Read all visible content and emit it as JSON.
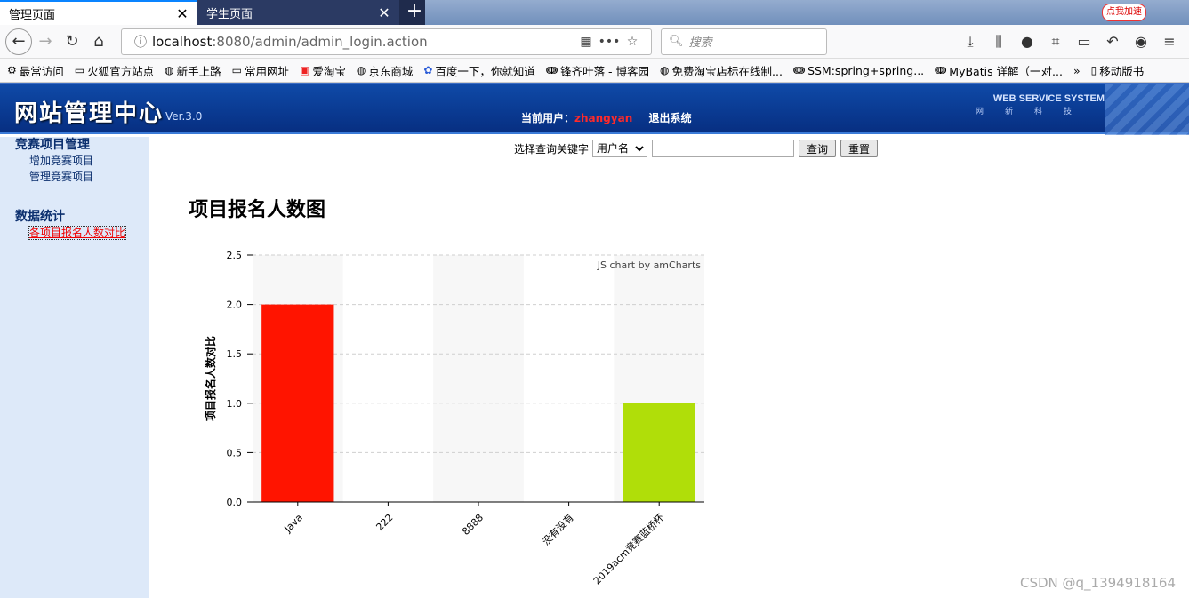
{
  "browser": {
    "tabs": [
      {
        "label": "管理页面",
        "close": "✕"
      },
      {
        "label": "学生页面",
        "close": "✕"
      }
    ],
    "newtab": "+",
    "accelerator": "点我加速",
    "url": {
      "host": "localhost",
      "path": ":8080/admin/admin_login.action"
    },
    "search_placeholder": "搜索",
    "bookmarks": [
      {
        "icon": "gear-icon",
        "label": "最常访问"
      },
      {
        "icon": "folder-icon",
        "label": "火狐官方站点"
      },
      {
        "icon": "globe-icon",
        "label": "新手上路"
      },
      {
        "icon": "folder-icon",
        "label": "常用网址"
      },
      {
        "icon": "taobao-icon",
        "label": "爱淘宝"
      },
      {
        "icon": "globe-icon",
        "label": "京东商城"
      },
      {
        "icon": "paw-icon",
        "label": "百度一下，你就知道"
      },
      {
        "icon": "cnblogs-icon",
        "label": "锋齐叶落 - 博客园"
      },
      {
        "icon": "globe-icon",
        "label": "免费淘宝店标在线制..."
      },
      {
        "icon": "cnblogs-icon",
        "label": "SSM:spring+spring..."
      },
      {
        "icon": "cnblogs-icon",
        "label": "MyBatis 详解（一对..."
      },
      {
        "icon": "overflow-icon",
        "label": "»"
      },
      {
        "icon": "mobile-icon",
        "label": "移动版书"
      }
    ]
  },
  "header": {
    "logo": "网站管理中心",
    "version": "Ver.3.0",
    "user_label": "当前用户：",
    "username": "zhangyan",
    "logout": "退出系统",
    "brand": "WEB SERVICE SYSTEM",
    "brand_sub": "网新科技"
  },
  "sidebar": {
    "groups": [
      {
        "title": "竞赛项目管理",
        "items": [
          "增加竞赛项目",
          "管理竞赛项目"
        ]
      },
      {
        "title": "数据统计",
        "items": [
          "各项目报名人数对比"
        ]
      }
    ]
  },
  "query": {
    "label": "选择查询关键字",
    "select_value": "用户名",
    "input_value": "",
    "search_button": "查询",
    "reset_button": "重置"
  },
  "page_title": "项目报名人数图",
  "chart_data": {
    "type": "bar",
    "categories": [
      "Java",
      "222",
      "8888",
      "没有没有",
      "2019acm竞赛蓝桥杯"
    ],
    "values": [
      2,
      0,
      0,
      0,
      1
    ],
    "colors": [
      "#ff1400",
      "#ff5e00",
      "#ff8f00",
      "#ffc300",
      "#b0de09"
    ],
    "ylabel": "项目报名人数对比",
    "ylim": [
      0,
      2.5
    ],
    "yticks": [
      "0.0",
      "0.5",
      "1.0",
      "1.5",
      "2.0",
      "2.5"
    ],
    "credit": "JS chart by amCharts",
    "grid": true
  },
  "watermark": "CSDN @q_1394918164"
}
